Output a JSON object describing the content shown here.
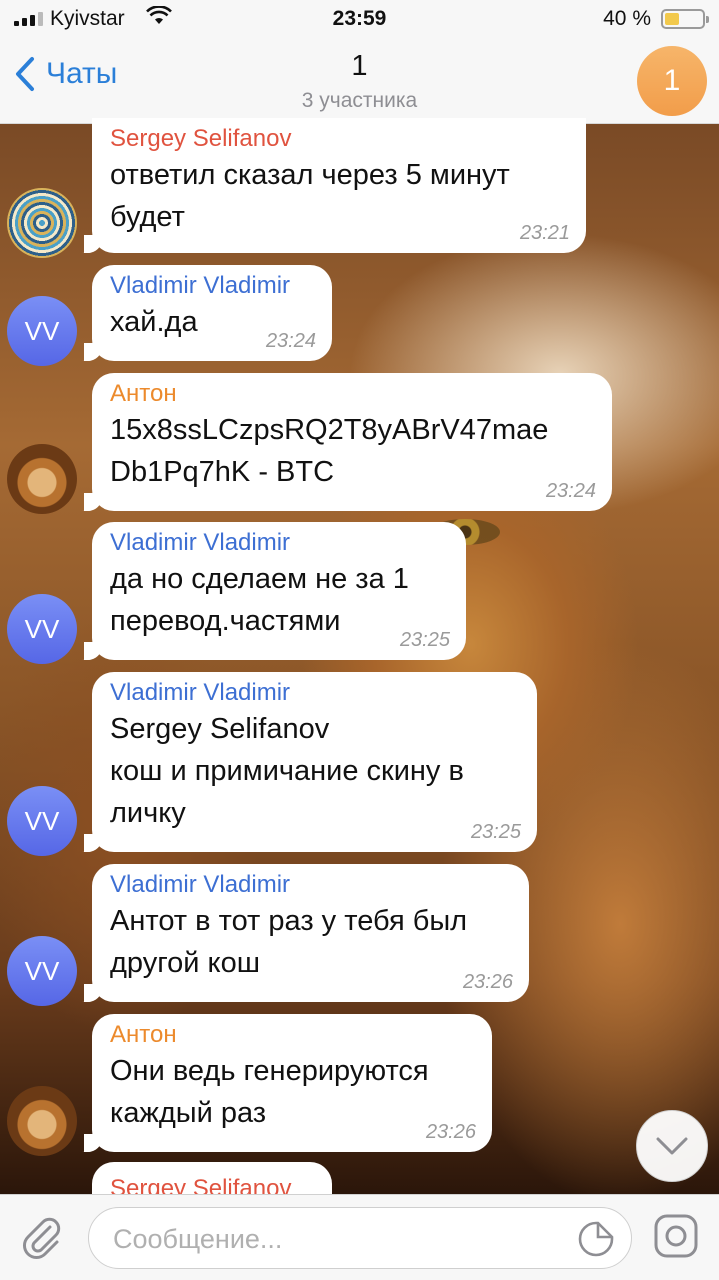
{
  "status_bar": {
    "carrier": "Kyivstar",
    "time": "23:59",
    "battery_percent": "40 %",
    "battery_level": 0.4
  },
  "header": {
    "back_label": "Чаты",
    "title": "1",
    "subtitle": "3 участника",
    "avatar_text": "1"
  },
  "messages": [
    {
      "sender": "Sergey Selifanov",
      "text": "ответил сказал через 5 минут\nбудет",
      "time": "23:21"
    },
    {
      "sender": "Vladimir Vladimir",
      "text": "хай.да",
      "time": "23:24",
      "avatar": "VV"
    },
    {
      "sender": "Антон",
      "text": "15x8ssLCzpsRQ2T8yABrV47mae\nDb1Pq7hK - BTC",
      "time": "23:24"
    },
    {
      "sender": "Vladimir Vladimir",
      "text": "да но сделаем не за 1\nперевод.частями",
      "time": "23:25",
      "avatar": "VV"
    },
    {
      "sender": "Vladimir Vladimir",
      "text": "Sergey Selifanov\nкош и примичание скину в\nличку",
      "time": "23:25",
      "avatar": "VV"
    },
    {
      "sender": "Vladimir Vladimir",
      "text": "Антот в тот раз у тебя был\nдругой кош",
      "time": "23:26",
      "avatar": "VV"
    },
    {
      "sender": "Антон",
      "text": "Они ведь генерируются\nкаждый раз",
      "time": "23:26"
    },
    {
      "sender": "Sergey Selifanov"
    }
  ],
  "input": {
    "placeholder": "Сообщение..."
  },
  "icons": {
    "back": "chevron-left-icon",
    "attach": "paperclip-icon",
    "sticker": "sticker-icon",
    "camera": "camera-icon",
    "scroll": "chevron-down-icon"
  },
  "colors": {
    "accent": "#2b7fd8",
    "sender_sergey": "#e0533f",
    "sender_vladimir": "#3d6fd3",
    "sender_anton": "#ec8a2c"
  }
}
